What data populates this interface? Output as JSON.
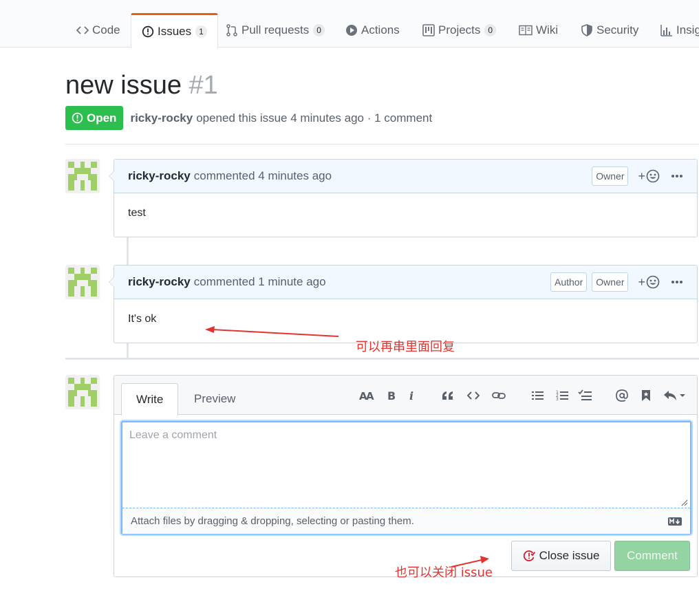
{
  "repo_nav": {
    "tabs": [
      {
        "label": "Code",
        "icon": "code-icon"
      },
      {
        "label": "Issues",
        "count": "1",
        "icon": "issue-opened-icon",
        "selected": true
      },
      {
        "label": "Pull requests",
        "count": "0",
        "icon": "git-pull-request-icon"
      },
      {
        "label": "Actions",
        "icon": "play-icon"
      },
      {
        "label": "Projects",
        "count": "0",
        "icon": "project-icon"
      },
      {
        "label": "Wiki",
        "icon": "book-icon"
      },
      {
        "label": "Security",
        "icon": "shield-icon"
      },
      {
        "label": "Insig",
        "icon": "graph-icon"
      }
    ],
    "selected_color": "#e36209"
  },
  "issue": {
    "title": "new issue",
    "number": "#1",
    "state": "Open",
    "state_color": "#2cbe4e",
    "author": "ricky-rocky",
    "summary": "opened this issue 4 minutes ago · 1 comment"
  },
  "comments": [
    {
      "author": "ricky-rocky",
      "action": "commented 4 minutes ago",
      "badges": [
        "Owner"
      ],
      "body": "test"
    },
    {
      "author": "ricky-rocky",
      "action": "commented 1 minute ago",
      "badges": [
        "Author",
        "Owner"
      ],
      "body": "It's ok"
    }
  ],
  "new_comment": {
    "tabs": {
      "write": "Write",
      "preview": "Preview"
    },
    "toolbar": [
      "text-size-icon",
      "bold-icon",
      "italic-icon",
      "quote-icon",
      "code-icon",
      "link-icon",
      "unordered-list-icon",
      "ordered-list-icon",
      "task-list-icon",
      "mention-icon",
      "bookmark-icon",
      "reply-icon"
    ],
    "placeholder": "Leave a comment",
    "attach_hint": "Attach files by dragging & dropping, selecting or pasting them.",
    "close_label": "Close issue",
    "submit_label": "Comment"
  },
  "annotations": {
    "reply_note": "可以再串里面回复",
    "close_note": "也可以关闭 issue",
    "color": "#e3342f"
  }
}
